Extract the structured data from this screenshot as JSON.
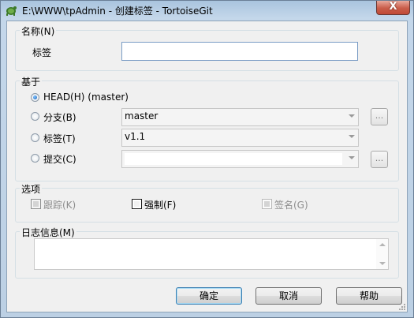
{
  "window": {
    "title": "E:\\WWW\\tpAdmin - 创建标签 - TortoiseGit",
    "close_symbol": "X"
  },
  "name_group": {
    "label": "名称(N)",
    "tag_label": "标签",
    "tag_value": ""
  },
  "base_group": {
    "label": "基于",
    "head_option": "HEAD(H) (master)",
    "branch_option": "分支(B)",
    "branch_value": "master",
    "tag_option": "标签(T)",
    "tag_value": "v1.1",
    "commit_option": "提交(C)",
    "commit_value": "",
    "ellipsis": "...",
    "selected": "head"
  },
  "options_group": {
    "label": "选项",
    "track": "跟踪(K)",
    "force": "强制(F)",
    "sign": "签名(G)"
  },
  "message_group": {
    "label": "日志信息(M)",
    "message_value": ""
  },
  "buttons": {
    "ok": "确定",
    "cancel": "取消",
    "help": "帮助"
  }
}
